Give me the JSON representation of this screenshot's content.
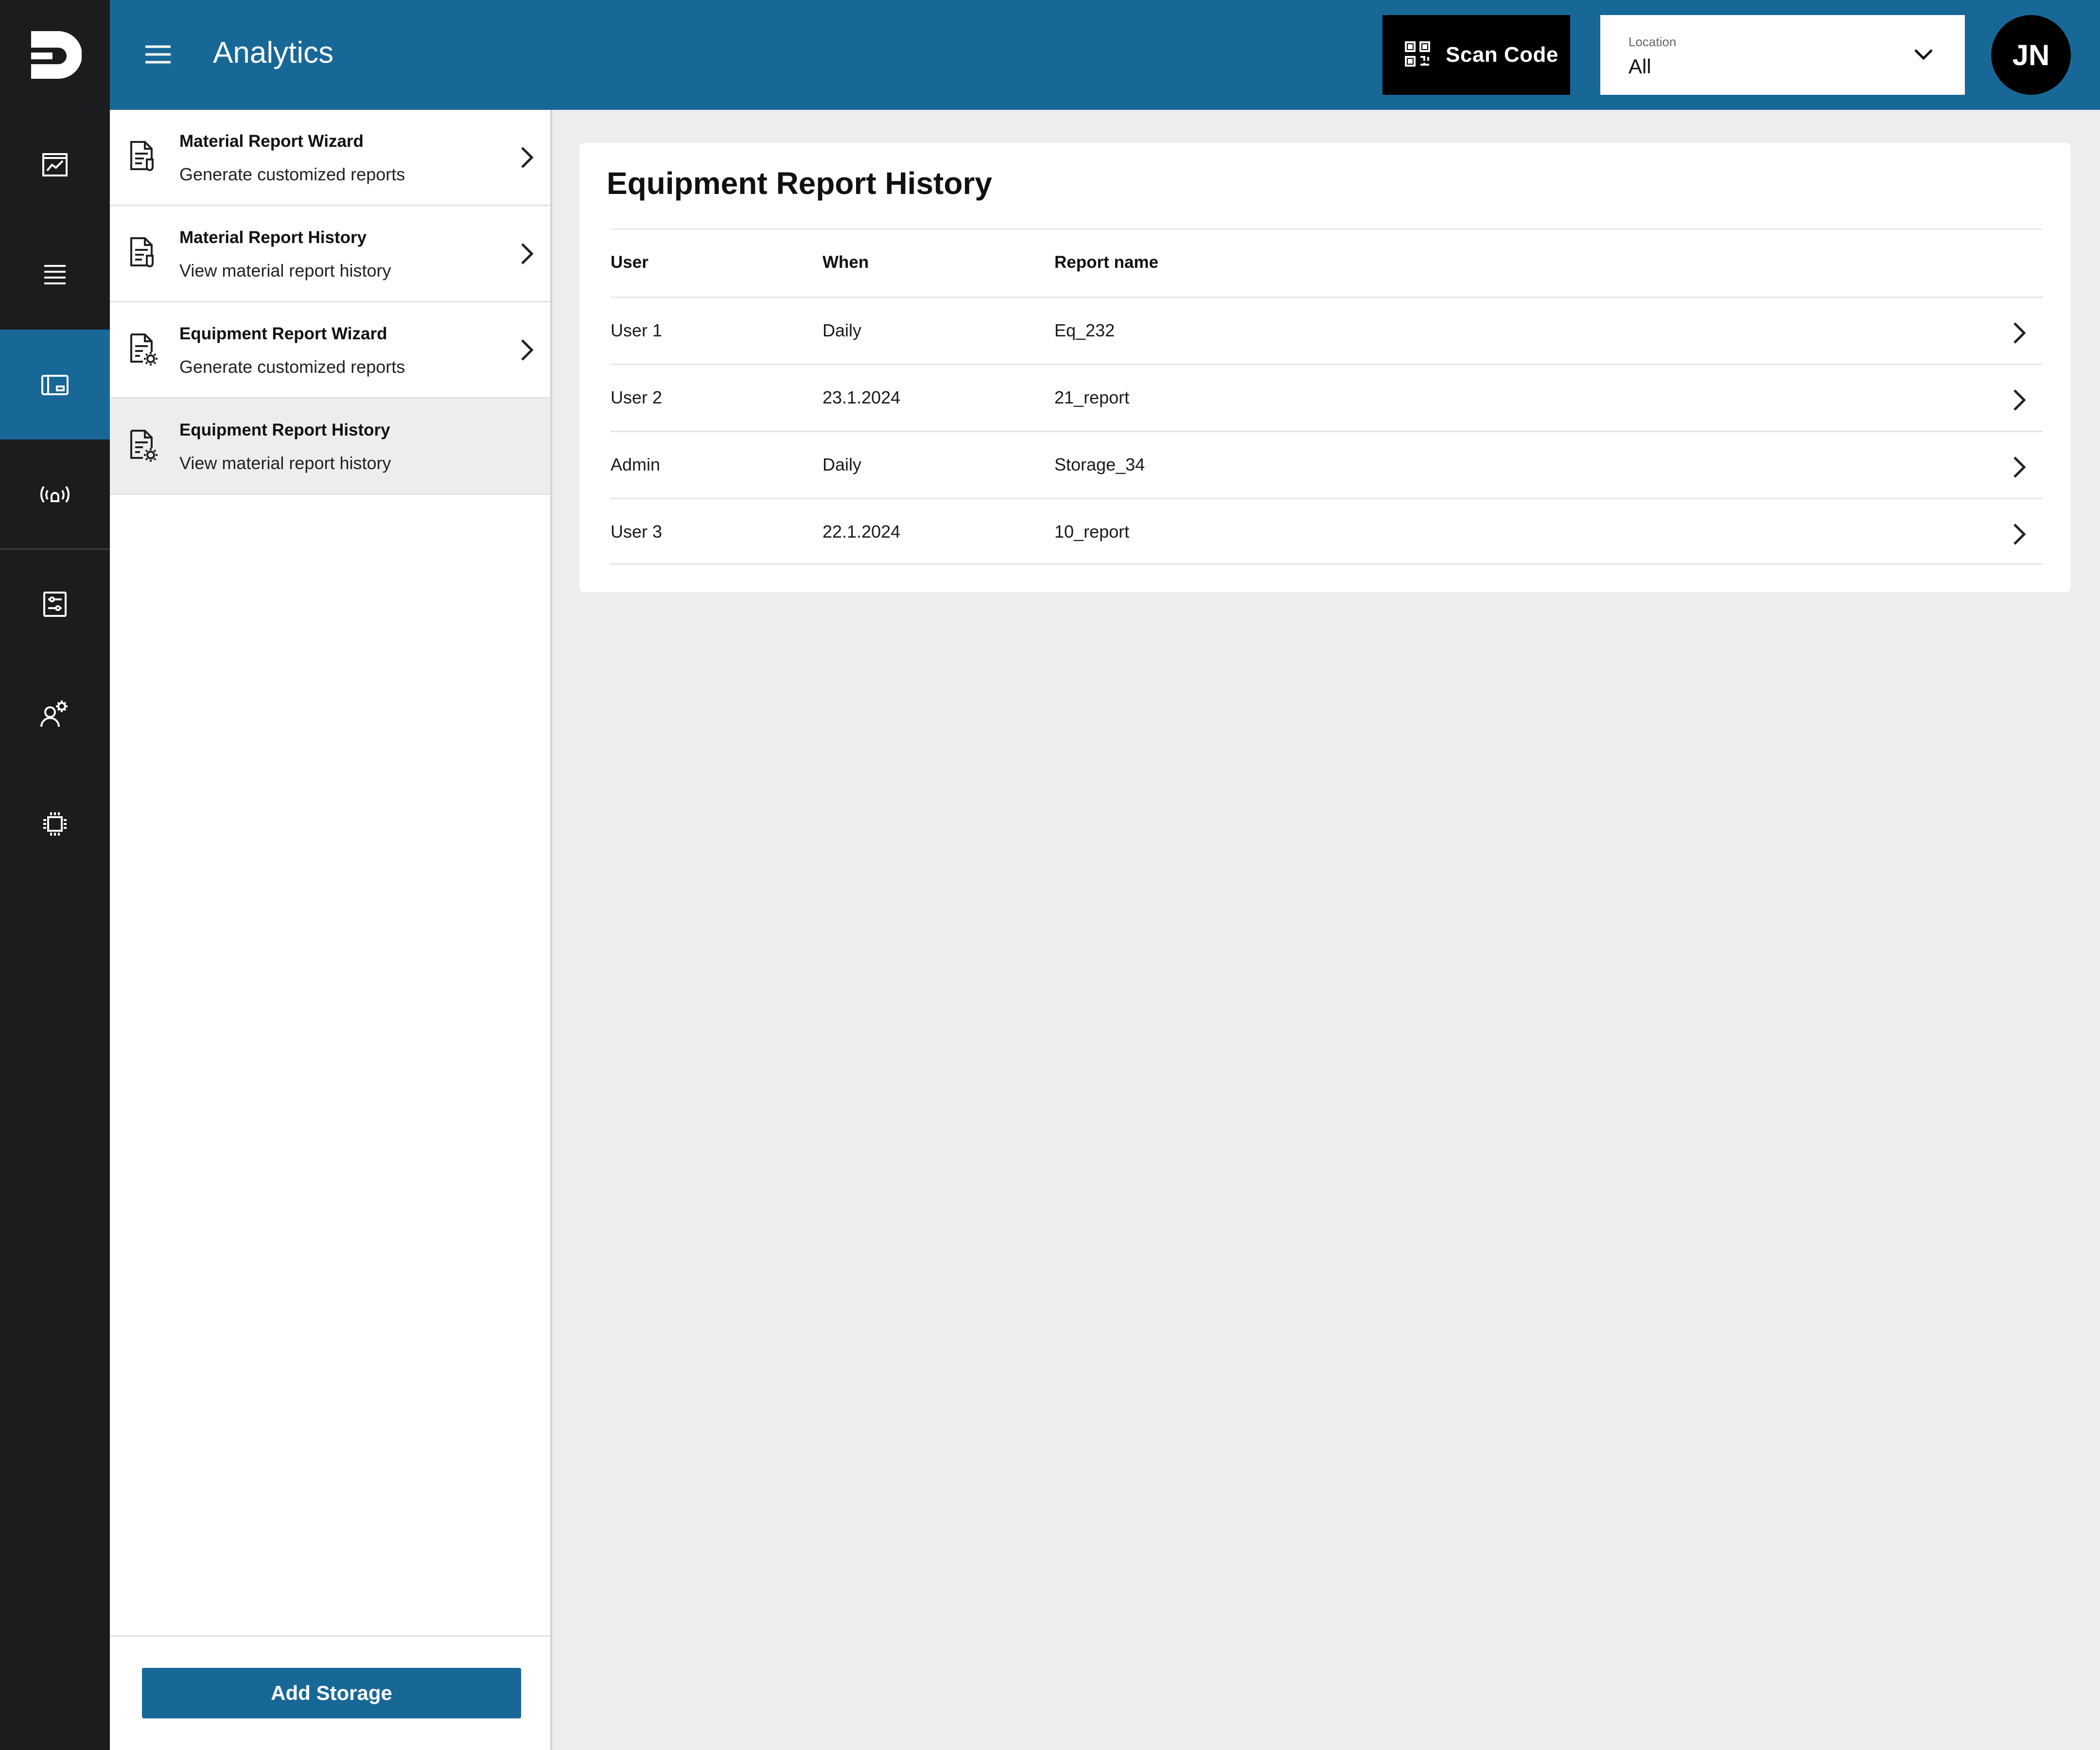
{
  "header": {
    "title": "Analytics",
    "scan_label": "Scan Code",
    "location_label": "Location",
    "location_value": "All",
    "avatar_initials": "JN"
  },
  "rail": {
    "logo": "brand-logo",
    "items": [
      {
        "icon": "chart-icon"
      },
      {
        "icon": "list-icon"
      },
      {
        "icon": "dashboard-icon",
        "active": true
      },
      {
        "icon": "sensor-icon"
      },
      {
        "icon": "settings-panel-icon"
      },
      {
        "icon": "user-settings-icon"
      },
      {
        "icon": "chip-icon"
      }
    ]
  },
  "subnav": {
    "items": [
      {
        "title": "Material Report Wizard",
        "desc": "Generate customized reports"
      },
      {
        "title": "Material Report History",
        "desc": "View material report history"
      },
      {
        "title": "Equipment Report Wizard",
        "desc": "Generate customized reports"
      },
      {
        "title": "Equipment Report History",
        "desc": "View material report history",
        "active": true
      }
    ],
    "add_button": "Add Storage"
  },
  "main": {
    "title": "Equipment Report History",
    "columns": [
      "User",
      "When",
      "Report name"
    ],
    "rows": [
      {
        "user": "User 1",
        "when": "Daily",
        "report": "Eq_232"
      },
      {
        "user": "User 2",
        "when": "23.1.2024",
        "report": "21_report"
      },
      {
        "user": "Admin",
        "when": "Daily",
        "report": "Storage_34"
      },
      {
        "user": "User 3",
        "when": "22.1.2024",
        "report": "10_report"
      }
    ]
  },
  "colors": {
    "brand": "#186897",
    "rail": "#1b1c1e",
    "background": "#ededed"
  }
}
